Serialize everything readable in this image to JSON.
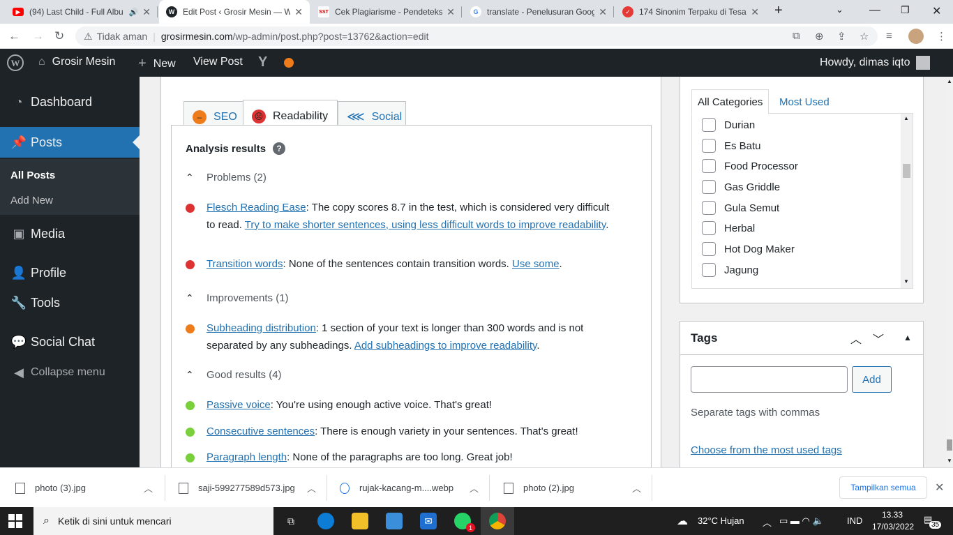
{
  "browser": {
    "tabs": [
      {
        "title": "(94) Last Child - Full Albu",
        "active": false,
        "favicon": "youtube-icon",
        "audio": true
      },
      {
        "title": "Edit Post ‹ Grosir Mesin — W",
        "active": true,
        "favicon": "wordpress-icon"
      },
      {
        "title": "Cek Plagiarisme - Pendeteksi",
        "active": false,
        "favicon": "sst-icon",
        "favicon_text": "SST"
      },
      {
        "title": "translate - Penelusuran Goog",
        "active": false,
        "favicon": "google-icon",
        "favicon_text": "G"
      },
      {
        "title": "174 Sinonim Terpaku di Tesa",
        "active": false,
        "favicon": "check-icon"
      }
    ],
    "new_tab": "+",
    "address": {
      "security_text": "Tidak aman",
      "host": "grosirmesin.com",
      "path": "/wp-admin/post.php?post=13762&action=edit"
    }
  },
  "adminbar": {
    "site_name": "Grosir Mesin",
    "new_label": "New",
    "view_post_label": "View Post",
    "howdy": "Howdy, dimas iqto"
  },
  "sidebar": {
    "items": [
      {
        "label": "Dashboard",
        "icon": "dashboard-icon"
      },
      {
        "label": "Posts",
        "icon": "pin-icon",
        "current": true
      },
      {
        "label": "Media",
        "icon": "media-icon"
      },
      {
        "label": "Profile",
        "icon": "user-icon"
      },
      {
        "label": "Tools",
        "icon": "wrench-icon"
      },
      {
        "label": "Social Chat",
        "icon": "chat-icon"
      },
      {
        "label": "Collapse menu",
        "icon": "collapse-icon"
      }
    ],
    "submenu": [
      {
        "label": "All Posts",
        "current": true
      },
      {
        "label": "Add New"
      }
    ]
  },
  "yoast": {
    "tabs": [
      {
        "label": "SEO",
        "face": "neutral"
      },
      {
        "label": "Readability",
        "face": "sad",
        "active": true
      },
      {
        "label": "Social"
      }
    ],
    "analysis_title": "Analysis results",
    "groups": {
      "problems": "Problems (2)",
      "improvements": "Improvements (1)",
      "good": "Good results (4)"
    },
    "results": {
      "flesch": {
        "link": "Flesch Reading Ease",
        "text": ": The copy scores 8.7 in the test, which is considered very difficult to read. ",
        "link2": "Try to make shorter sentences, using less difficult words to improve readability",
        "tail": "."
      },
      "transition": {
        "link": "Transition words",
        "text": ": None of the sentences contain transition words. ",
        "link2": "Use some",
        "tail": "."
      },
      "subheading": {
        "link": "Subheading distribution",
        "text": ": 1 section of your text is longer than 300 words and is not separated by any subheadings. ",
        "link2": "Add subheadings to improve readability",
        "tail": "."
      },
      "passive": {
        "link": "Passive voice",
        "text": ": You're using enough active voice. That's great!"
      },
      "consecutive": {
        "link": "Consecutive sentences",
        "text": ": There is enough variety in your sentences. That's great!"
      },
      "paragraph": {
        "link": "Paragraph length",
        "text": ": None of the paragraphs are too long. Great job!"
      }
    }
  },
  "categories": {
    "tab_all": "All Categories",
    "tab_most": "Most Used",
    "items": [
      "Durian",
      "Es Batu",
      "Food Processor",
      "Gas Griddle",
      "Gula Semut",
      "Herbal",
      "Hot Dog Maker",
      "Jagung"
    ]
  },
  "tags": {
    "title": "Tags",
    "input_value": "",
    "add_label": "Add",
    "hint": "Separate tags with commas",
    "choose_link": "Choose from the most used tags"
  },
  "downloads": {
    "items": [
      "photo (3).jpg",
      "saji-599277589d573.jpg",
      "rujak-kacang-m....webp",
      "photo (2).jpg"
    ],
    "show_all": "Tampilkan semua"
  },
  "taskbar": {
    "search_placeholder": "Ketik di sini untuk mencari",
    "weather": "32°C  Hujan",
    "lang": "IND",
    "time": "13.33",
    "date": "17/03/2022",
    "whatsapp_badge": "1",
    "notif_count": "35"
  },
  "colors": {
    "wp_blue": "#2271b1",
    "admin_dark": "#1d2327",
    "red": "#dc3232",
    "orange": "#ee7c1b",
    "green": "#7ad03a"
  }
}
